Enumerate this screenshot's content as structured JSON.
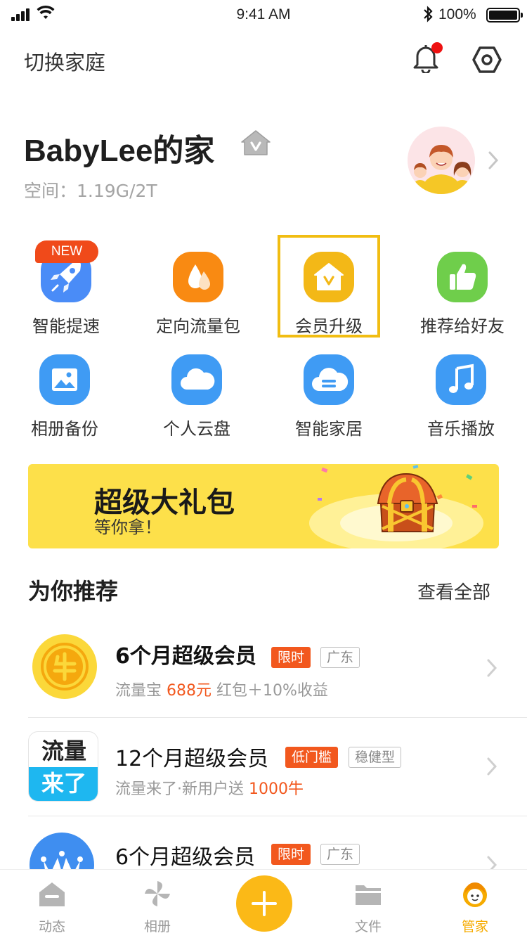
{
  "status_bar": {
    "time": "9:41 AM",
    "battery": "100%"
  },
  "header": {
    "switch_family": "切换家庭"
  },
  "family": {
    "name": "BabyLee的家",
    "space": "空间：1.19G/2T"
  },
  "grid": [
    {
      "label": "智能提速",
      "icon": "rocket-icon",
      "color": "#4a8cf7",
      "badge": "NEW"
    },
    {
      "label": "定向流量包",
      "icon": "drops-icon",
      "color": "#f98a12"
    },
    {
      "label": "会员升级",
      "icon": "vip-house-icon",
      "color": "#f3b817"
    },
    {
      "label": "推荐给好友",
      "icon": "thumbs-up-icon",
      "color": "#6fce4b"
    },
    {
      "label": "相册备份",
      "icon": "image-icon",
      "color": "#3f9bf4"
    },
    {
      "label": "个人云盘",
      "icon": "cloud-icon",
      "color": "#3f9bf4"
    },
    {
      "label": "智能家居",
      "icon": "smart-cloud-icon",
      "color": "#3f9bf4"
    },
    {
      "label": "音乐播放",
      "icon": "music-note-icon",
      "color": "#3f9bf4"
    }
  ],
  "banner": {
    "title": "超级大礼包",
    "subtitle": "等你拿！"
  },
  "recommend": {
    "title": "为你推荐",
    "view_all": "查看全部",
    "items": [
      {
        "name": "6个月超级会员",
        "tags": [
          "限时",
          "广东"
        ],
        "desc_pre": "流量宝 ",
        "desc_hl": "688元",
        "desc_post": " 红包＋10%收益",
        "thumb": "coin-icon"
      },
      {
        "name": "12个月超级会员",
        "tags": [
          "低门槛",
          "稳健型"
        ],
        "desc_pre": "流量来了·新用户送 ",
        "desc_hl": "1000牛",
        "desc_post": "",
        "thumb_line1": "流量",
        "thumb_line2": "来了"
      },
      {
        "name": "6个月超级会员",
        "tags": [
          "限时",
          "广东"
        ],
        "thumb": "crown-icon"
      }
    ]
  },
  "tabbar": {
    "tabs": [
      {
        "label": "动态"
      },
      {
        "label": "相册"
      },
      {
        "label": "文件"
      },
      {
        "label": "管家"
      }
    ]
  },
  "colors": {
    "accent": "#fbb917",
    "highlight": "#f2581e",
    "brand_blue": "#3f9bf4"
  }
}
